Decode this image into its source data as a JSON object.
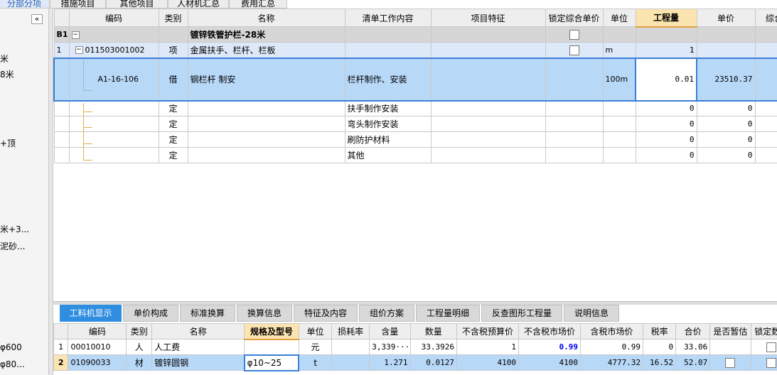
{
  "top_tabs": [
    "分部分项",
    "措施项目",
    "其他项目",
    "人材机汇总",
    "费用汇总"
  ],
  "sidebar": {
    "collapse_glyph": "«",
    "fragments": [
      "米",
      "8米",
      "+顶",
      "米+3...",
      "泥砂...",
      "φ600",
      "φ80..."
    ]
  },
  "main_table": {
    "headers": [
      "编码",
      "类别",
      "名称",
      "清单工作内容",
      "项目特征",
      "锁定综合单价",
      "单位",
      "工程量",
      "单价",
      "综合"
    ],
    "rows": [
      {
        "rownum": "B1",
        "code": "",
        "type": "",
        "name": "镀锌铁管护栏-28米",
        "work": "",
        "feature": "",
        "unit": "",
        "qty": "",
        "price": ""
      },
      {
        "rownum": "1",
        "code": "011503001002",
        "type": "项",
        "name": "金属扶手、栏杆、栏板",
        "work": "",
        "feature": "",
        "unit": "m",
        "qty": "1",
        "price": ""
      },
      {
        "rownum": "",
        "code": "A1-16-106",
        "type": "借",
        "name": "钢栏杆 制安",
        "work": "栏杆制作、安装",
        "feature": "",
        "unit": "100m",
        "qty": "0.01",
        "price": "23510.37"
      },
      {
        "rownum": "",
        "code": "",
        "type": "定",
        "name": "",
        "work": "扶手制作安装",
        "feature": "",
        "unit": "",
        "qty": "0",
        "price": "0"
      },
      {
        "rownum": "",
        "code": "",
        "type": "定",
        "name": "",
        "work": "弯头制作安装",
        "feature": "",
        "unit": "",
        "qty": "0",
        "price": "0"
      },
      {
        "rownum": "",
        "code": "",
        "type": "定",
        "name": "",
        "work": "刷防护材料",
        "feature": "",
        "unit": "",
        "qty": "0",
        "price": "0"
      },
      {
        "rownum": "",
        "code": "",
        "type": "定",
        "name": "",
        "work": "其他",
        "feature": "",
        "unit": "",
        "qty": "0",
        "price": "0"
      }
    ]
  },
  "bottom_tabs": [
    "工料机显示",
    "单价构成",
    "标准换算",
    "换算信息",
    "特征及内容",
    "组价方案",
    "工程量明细",
    "反查图形工程量",
    "说明信息"
  ],
  "resource_table": {
    "headers": [
      "编码",
      "类别",
      "名称",
      "规格及型号",
      "单位",
      "损耗率",
      "含量",
      "数量",
      "不含税预算价",
      "不含税市场价",
      "含税市场价",
      "税率",
      "合价",
      "是否暂估",
      "锁定数量"
    ],
    "rows": [
      {
        "rownum": "1",
        "code": "00010010",
        "type": "人",
        "name": "人工费",
        "spec": "",
        "unit": "元",
        "loss": "",
        "content": "3,339···",
        "qty": "33.3926",
        "budget": "1",
        "market": "0.99",
        "market_tax": "0.99",
        "tax": "0",
        "total": "33.06"
      },
      {
        "rownum": "2",
        "code": "01090033",
        "type": "材",
        "name": "镀锌圆钢",
        "spec": "φ10~25",
        "unit": "t",
        "loss": "",
        "content": "1.271",
        "qty": "0.0127",
        "budget": "4100",
        "market": "4100",
        "market_tax": "4777.32",
        "tax": "16.52",
        "total": "52.07"
      }
    ]
  },
  "colors": {
    "selected_row": "#b8d8f8",
    "header_highlight": "#fce4b0",
    "group_row": "#d6d6d6",
    "market_price": "#0000ee"
  }
}
